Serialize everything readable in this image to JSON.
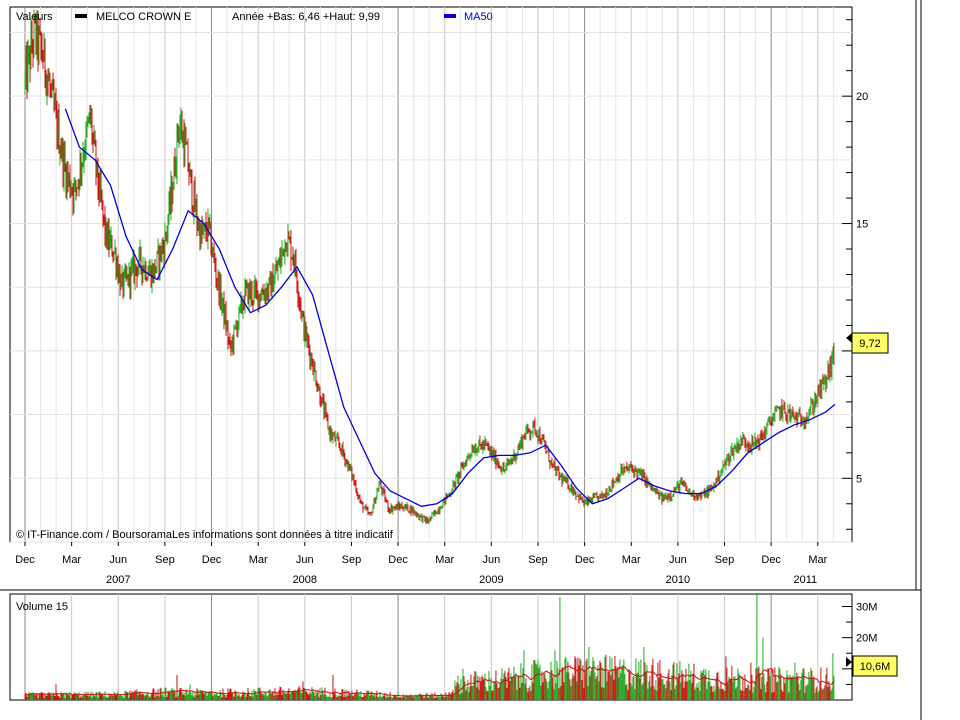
{
  "chart_data": [
    {
      "type": "candlestick",
      "header": {
        "label": "Valeurs",
        "series_name": "MELCO CROWN E",
        "stats": "Année +Bas: 6,46 +Haut: 9,99",
        "ma_name": "MA50"
      },
      "credit": "© IT-Finance.com / BoursoramaLes informations sont données à titre indicatif",
      "last_value_label": "9,72",
      "y_ticks": [
        {
          "value": 5,
          "label": "5"
        },
        {
          "value": 15,
          "label": "15"
        },
        {
          "value": 20,
          "label": "20"
        }
      ],
      "ylim": [
        2.5,
        23.5
      ],
      "x_month_ticks": [
        {
          "m": 0,
          "label": "Dec"
        },
        {
          "m": 3,
          "label": "Mar"
        },
        {
          "m": 6,
          "label": "Jun"
        },
        {
          "m": 9,
          "label": "Sep"
        },
        {
          "m": 12,
          "label": "Dec"
        },
        {
          "m": 15,
          "label": "Mar"
        },
        {
          "m": 18,
          "label": "Jun"
        },
        {
          "m": 21,
          "label": "Sep"
        },
        {
          "m": 24,
          "label": "Dec"
        },
        {
          "m": 27,
          "label": "Mar"
        },
        {
          "m": 30,
          "label": "Jun"
        },
        {
          "m": 33,
          "label": "Sep"
        },
        {
          "m": 36,
          "label": "Dec"
        },
        {
          "m": 39,
          "label": "Mar"
        },
        {
          "m": 42,
          "label": "Jun"
        },
        {
          "m": 45,
          "label": "Sep"
        },
        {
          "m": 48,
          "label": "Dec"
        },
        {
          "m": 51,
          "label": "Mar"
        }
      ],
      "year_labels": [
        {
          "m": 6,
          "label": "2007"
        },
        {
          "m": 18,
          "label": "2008"
        },
        {
          "m": 30,
          "label": "2009"
        },
        {
          "m": 42,
          "label": "2010"
        },
        {
          "m": 50.2,
          "label": "2011"
        }
      ],
      "xlim": [
        0,
        52.3
      ],
      "price_path": [
        [
          0,
          20.5
        ],
        [
          0.6,
          22.5
        ],
        [
          1.2,
          21.5
        ],
        [
          2,
          19
        ],
        [
          2.6,
          17
        ],
        [
          3.2,
          16.2
        ],
        [
          3.8,
          18
        ],
        [
          4.2,
          19.2
        ],
        [
          4.6,
          17
        ],
        [
          5.2,
          14.5
        ],
        [
          5.8,
          13.8
        ],
        [
          6.2,
          12.5
        ],
        [
          6.8,
          13
        ],
        [
          7.4,
          13.5
        ],
        [
          8.2,
          13
        ],
        [
          9,
          14.3
        ],
        [
          9.5,
          16.5
        ],
        [
          9.9,
          19
        ],
        [
          10.3,
          18
        ],
        [
          10.8,
          16
        ],
        [
          11.3,
          14.5
        ],
        [
          11.8,
          14.8
        ],
        [
          12.3,
          13
        ],
        [
          12.8,
          11.5
        ],
        [
          13.2,
          10
        ],
        [
          13.6,
          11
        ],
        [
          14.2,
          12.3
        ],
        [
          15,
          12.2
        ],
        [
          15.8,
          12.5
        ],
        [
          16.4,
          13.5
        ],
        [
          16.8,
          14.5
        ],
        [
          17.3,
          13.7
        ],
        [
          17.9,
          11
        ],
        [
          18.5,
          9.5
        ],
        [
          19,
          8.2
        ],
        [
          19.6,
          6.8
        ],
        [
          20.3,
          6.2
        ],
        [
          21,
          5.2
        ],
        [
          21.6,
          4
        ],
        [
          22.2,
          3.5
        ],
        [
          22.8,
          4.8
        ],
        [
          23.4,
          3.8
        ],
        [
          24.2,
          3.9
        ],
        [
          24.8,
          3.8
        ],
        [
          25.4,
          3.5
        ],
        [
          25.9,
          3.3
        ],
        [
          26.6,
          3.8
        ],
        [
          27.4,
          4.5
        ],
        [
          28.2,
          5.5
        ],
        [
          28.8,
          6.2
        ],
        [
          29.6,
          6.3
        ],
        [
          30.2,
          5.8
        ],
        [
          30.8,
          5.3
        ],
        [
          31.6,
          6
        ],
        [
          32.2,
          6.8
        ],
        [
          32.8,
          7
        ],
        [
          33.4,
          6.3
        ],
        [
          33.9,
          5.5
        ],
        [
          34.5,
          5
        ],
        [
          35.2,
          4.6
        ],
        [
          36,
          4
        ],
        [
          36.6,
          4.2
        ],
        [
          37.2,
          4.3
        ],
        [
          37.8,
          4.8
        ],
        [
          38.4,
          5.3
        ],
        [
          39,
          5.4
        ],
        [
          39.7,
          5.1
        ],
        [
          40.3,
          4.6
        ],
        [
          41,
          4.2
        ],
        [
          41.6,
          4.4
        ],
        [
          42.2,
          4.8
        ],
        [
          42.8,
          4.4
        ],
        [
          43.5,
          4.3
        ],
        [
          44.2,
          4.6
        ],
        [
          44.8,
          5.3
        ],
        [
          45.5,
          6.1
        ],
        [
          46.2,
          6.5
        ],
        [
          46.8,
          6.3
        ],
        [
          47.4,
          6.6
        ],
        [
          48,
          7.3
        ],
        [
          48.6,
          7.7
        ],
        [
          49.2,
          7.5
        ],
        [
          49.8,
          7.3
        ],
        [
          50.4,
          7.5
        ],
        [
          51,
          8.3
        ],
        [
          51.5,
          8.8
        ],
        [
          51.9,
          9.6
        ],
        [
          52.1,
          9.72
        ]
      ],
      "ma50_path": [
        [
          2.6,
          19.5
        ],
        [
          3.5,
          18
        ],
        [
          4.5,
          17.5
        ],
        [
          5.5,
          16.5
        ],
        [
          6.5,
          14.5
        ],
        [
          7.5,
          13.2
        ],
        [
          8.5,
          12.8
        ],
        [
          9.5,
          14
        ],
        [
          10.5,
          15.5
        ],
        [
          11.5,
          15
        ],
        [
          12.5,
          14
        ],
        [
          13.5,
          12.5
        ],
        [
          14.5,
          11.5
        ],
        [
          15.5,
          11.8
        ],
        [
          16.5,
          12.5
        ],
        [
          17.5,
          13.3
        ],
        [
          18.5,
          12.2
        ],
        [
          19.5,
          10
        ],
        [
          20.5,
          7.8
        ],
        [
          21.5,
          6.5
        ],
        [
          22.5,
          5.2
        ],
        [
          23.5,
          4.5
        ],
        [
          24.5,
          4.2
        ],
        [
          25.5,
          3.9
        ],
        [
          26.5,
          4
        ],
        [
          27.5,
          4.4
        ],
        [
          28.5,
          5.2
        ],
        [
          29.5,
          5.8
        ],
        [
          30.5,
          5.9
        ],
        [
          31.5,
          5.9
        ],
        [
          32.5,
          6
        ],
        [
          33.5,
          6.3
        ],
        [
          34.5,
          5.5
        ],
        [
          35.5,
          4.6
        ],
        [
          36.5,
          4
        ],
        [
          37.5,
          4.2
        ],
        [
          38.5,
          4.6
        ],
        [
          39.5,
          5
        ],
        [
          40.5,
          4.7
        ],
        [
          41.5,
          4.5
        ],
        [
          42.5,
          4.4
        ],
        [
          43.5,
          4.4
        ],
        [
          44.5,
          4.7
        ],
        [
          45.5,
          5.3
        ],
        [
          46.5,
          6
        ],
        [
          47.5,
          6.4
        ],
        [
          48.5,
          6.8
        ],
        [
          49.5,
          7.1
        ],
        [
          50.5,
          7.3
        ],
        [
          51.5,
          7.6
        ],
        [
          52.1,
          7.9
        ]
      ],
      "colors": {
        "up": "#1faa1f",
        "down": "#cc1111",
        "ma": "#0000dd",
        "grid": "#c8c8c8",
        "axis": "#000000",
        "badge_bg": "#ffff66"
      }
    },
    {
      "type": "bar",
      "title": "Volume 15",
      "y_ticks": [
        {
          "value": 20,
          "label": "20M"
        },
        {
          "value": 30,
          "label": "30M"
        }
      ],
      "ylim": [
        0,
        34
      ],
      "last_value_label": "10,6M",
      "volume_profile": [
        [
          0,
          1.5
        ],
        [
          6,
          1.8
        ],
        [
          9,
          2.5
        ],
        [
          12,
          2.2
        ],
        [
          18,
          2.8
        ],
        [
          24,
          1.6
        ],
        [
          27,
          1.4
        ],
        [
          28,
          5.5
        ],
        [
          31,
          6.5
        ],
        [
          33,
          8
        ],
        [
          36,
          9
        ],
        [
          40,
          8.5
        ],
        [
          44,
          7
        ],
        [
          48,
          6.5
        ],
        [
          52.1,
          6.5
        ]
      ],
      "volume_spikes": [
        [
          2,
          5
        ],
        [
          9.8,
          8
        ],
        [
          10.6,
          5
        ],
        [
          15.1,
          4
        ],
        [
          17.9,
          6
        ],
        [
          19.8,
          8
        ],
        [
          28.2,
          10
        ],
        [
          32.1,
          16
        ],
        [
          34.4,
          33
        ],
        [
          34.1,
          16
        ],
        [
          36.3,
          17
        ],
        [
          37.6,
          14
        ],
        [
          38.5,
          13
        ],
        [
          39.8,
          17
        ],
        [
          40.7,
          12
        ],
        [
          42.5,
          10
        ],
        [
          45.1,
          14
        ],
        [
          46.7,
          12
        ],
        [
          47.1,
          34
        ],
        [
          47.5,
          20
        ],
        [
          49.5,
          12
        ],
        [
          52,
          15
        ]
      ],
      "colors": {
        "up": "#1faa1f",
        "down": "#cc1111",
        "avg": "#cc1111"
      }
    }
  ]
}
